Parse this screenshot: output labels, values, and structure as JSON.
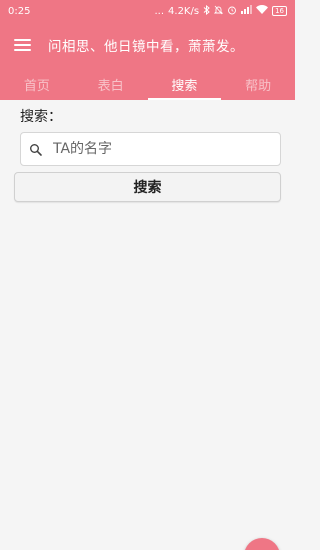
{
  "status_bar": {
    "time": "0:25",
    "dots": "...",
    "speed": "4.2K/s",
    "bluetooth_icon": "bluetooth-icon",
    "alarm_icon": "alarm-icon",
    "signal_icon": "signal-icon",
    "wifi_icon": "wifi-icon",
    "battery": "16"
  },
  "toolbar": {
    "menu_icon": "hamburger-menu-icon",
    "title": "问相思、他日镜中看，萧萧发。"
  },
  "tabs": [
    {
      "label": "首页",
      "active": false
    },
    {
      "label": "表白",
      "active": false
    },
    {
      "label": "搜索",
      "active": true
    },
    {
      "label": "帮助",
      "active": false
    }
  ],
  "search": {
    "label": "搜索：",
    "placeholder": "TA的名字",
    "button": "搜索"
  },
  "colors": {
    "accent": "#ef7685",
    "background": "#f5f5f5"
  }
}
